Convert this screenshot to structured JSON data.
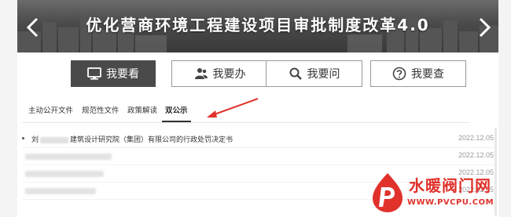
{
  "banner": {
    "title": "优化营商环境工程建设项目审批制度改革4.0"
  },
  "main_buttons": [
    {
      "label": "我要看",
      "icon": "monitor-icon",
      "active": true
    },
    {
      "label": "我要办",
      "icon": "users-icon",
      "active": false
    },
    {
      "label": "我要问",
      "icon": "search-icon",
      "active": false
    },
    {
      "label": "我要查",
      "icon": "question-icon",
      "active": false
    }
  ],
  "tabs": [
    {
      "label": "主动公开文件",
      "active": false
    },
    {
      "label": "规范性文件",
      "active": false
    },
    {
      "label": "政策解读",
      "active": false
    },
    {
      "label": "双公示",
      "active": true
    }
  ],
  "list": [
    {
      "title_prefix": "刘",
      "title_suffix": "建筑设计研究院（集团）有限公司的行政处罚决定书",
      "date": "2022.12.05"
    },
    {
      "title_prefix": "",
      "title_suffix": "",
      "date": "2022.12.05"
    },
    {
      "title_prefix": "",
      "title_suffix": "",
      "date": "2022.12.05"
    },
    {
      "title_prefix": "",
      "title_suffix": "",
      "date": "2022.12.05"
    }
  ],
  "watermark": {
    "text": "水暖阀门网",
    "url": "WWW.PVCPU.COM"
  },
  "colors": {
    "active_button": "#4a4a4a",
    "annotation_arrow": "#e0322b",
    "watermark": "#e0322b"
  }
}
